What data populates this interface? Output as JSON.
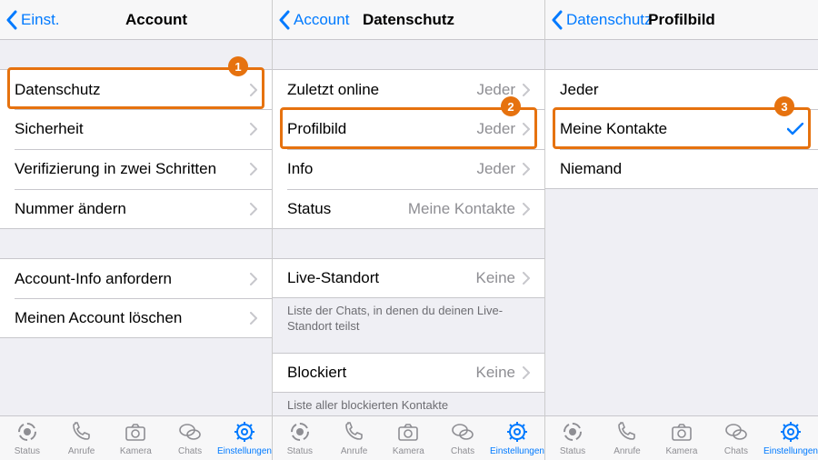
{
  "panels": [
    {
      "back": "Einst.",
      "title": "Account",
      "groups": [
        {
          "gap": "lg",
          "cells": [
            {
              "label": "Datenschutz",
              "chev": true,
              "hl": 1
            },
            {
              "label": "Sicherheit",
              "chev": true
            },
            {
              "label": "Verifizierung in zwei Schritten",
              "chev": true
            },
            {
              "label": "Nummer ändern",
              "chev": true
            }
          ]
        },
        {
          "gap": "lg",
          "cells": [
            {
              "label": "Account-Info anfordern",
              "chev": true
            },
            {
              "label": "Meinen Account löschen",
              "chev": true
            }
          ]
        }
      ]
    },
    {
      "back": "Account",
      "title": "Datenschutz",
      "groups": [
        {
          "gap": "lg",
          "cells": [
            {
              "label": "Zuletzt online",
              "value": "Jeder",
              "chev": true
            },
            {
              "label": "Profilbild",
              "value": "Jeder",
              "chev": true,
              "hl": 2
            },
            {
              "label": "Info",
              "value": "Jeder",
              "chev": true
            },
            {
              "label": "Status",
              "value": "Meine Kontakte",
              "chev": true
            }
          ]
        },
        {
          "gap": "lg",
          "cells": [
            {
              "label": "Live-Standort",
              "value": "Keine",
              "chev": true
            }
          ],
          "footer": "Liste der Chats, in denen du deinen Live-Standort teilst"
        },
        {
          "gap": "sm",
          "cells": [
            {
              "label": "Blockiert",
              "value": "Keine",
              "chev": true
            }
          ],
          "footer": "Liste aller blockierten Kontakte"
        }
      ]
    },
    {
      "back": "Datenschutz",
      "title": "Profilbild",
      "groups": [
        {
          "gap": "lg",
          "cells": [
            {
              "label": "Jeder"
            },
            {
              "label": "Meine Kontakte",
              "check": true,
              "hl": 3
            },
            {
              "label": "Niemand"
            }
          ]
        }
      ]
    }
  ],
  "tabs": [
    {
      "label": "Status",
      "icon": "status"
    },
    {
      "label": "Anrufe",
      "icon": "phone"
    },
    {
      "label": "Kamera",
      "icon": "camera"
    },
    {
      "label": "Chats",
      "icon": "chats"
    },
    {
      "label": "Einstellungen",
      "icon": "gear",
      "active": true
    }
  ],
  "colors": {
    "accent": "#007aff",
    "highlight": "#e6720f",
    "gray": "#8e8e93"
  }
}
